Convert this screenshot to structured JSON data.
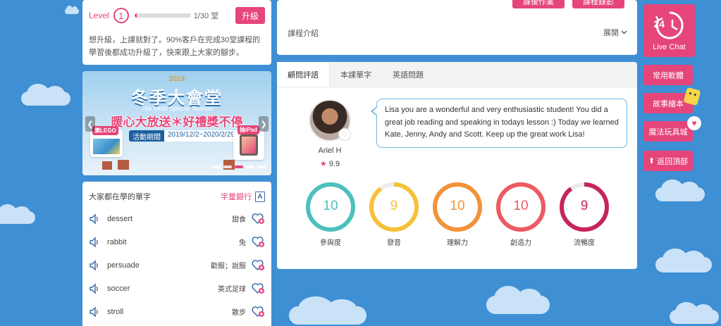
{
  "level": {
    "label": "Level",
    "number": "1",
    "progress_fraction": 0.04,
    "progress_text": "1/30 堂",
    "upgrade_label": "升級",
    "description": "想升級，上課就對了。90%客戶在完成30堂課程的學習後都成功升級了，快來跟上大家的腳步。"
  },
  "banner": {
    "year": "2019",
    "title": "冬季大會堂",
    "subtitle": "The Most Special Season",
    "headline": "暖心大放送＊好禮獎不停",
    "period_label": "活動期間",
    "period_value": "2019/12/2~2020/2/29",
    "badge_left": "樂LEGO",
    "badge_right": "抽iPad",
    "prev_icon": "chevron-left-icon",
    "next_icon": "chevron-right-icon"
  },
  "vocab": {
    "title": "大家都在學的單字",
    "bank_label": "字量銀行",
    "bank_icon": "A",
    "words": [
      {
        "word": "dessert",
        "definition": "甜食"
      },
      {
        "word": "rabbit",
        "definition": "兔"
      },
      {
        "word": "persuade",
        "definition": "勸服；說服"
      },
      {
        "word": "soccer",
        "definition": "英式足球"
      },
      {
        "word": "stroll",
        "definition": "散步"
      }
    ]
  },
  "course": {
    "button_1": "課後作業",
    "button_2": "課程錄影",
    "intro_label": "課程介紹",
    "expand_label": "展開"
  },
  "review": {
    "tabs": [
      "顧問評語",
      "本課單字",
      "英語問題"
    ],
    "teacher_name": "Ariel H",
    "teacher_rating": "9.9",
    "comment": "Lisa you are a wonderful and very enthusiastic student! You did a great job reading and speaking in todays lesson :) Today we learned Kate, Jenny, Andy and Scott. Keep up the great work Lisa!",
    "scores": [
      {
        "label": "參與度",
        "value": "10",
        "fraction": 1.0,
        "color": "#4cc0bd"
      },
      {
        "label": "發音",
        "value": "9",
        "fraction": 0.9,
        "color": "#f6c139"
      },
      {
        "label": "理解力",
        "value": "10",
        "fraction": 1.0,
        "color": "#f39237"
      },
      {
        "label": "創造力",
        "value": "10",
        "fraction": 1.0,
        "color": "#ec5a62"
      },
      {
        "label": "流暢度",
        "value": "9",
        "fraction": 0.9,
        "color": "#c6255b"
      }
    ]
  },
  "sidebar": {
    "live_number": "24",
    "live_label": "Live Chat",
    "items": [
      "常用軟體",
      "故事繪本",
      "魔法玩具城",
      "返回頂部"
    ]
  },
  "colors": {
    "brand_pink": "#e5457a",
    "background_blue": "#3f8fd4"
  }
}
